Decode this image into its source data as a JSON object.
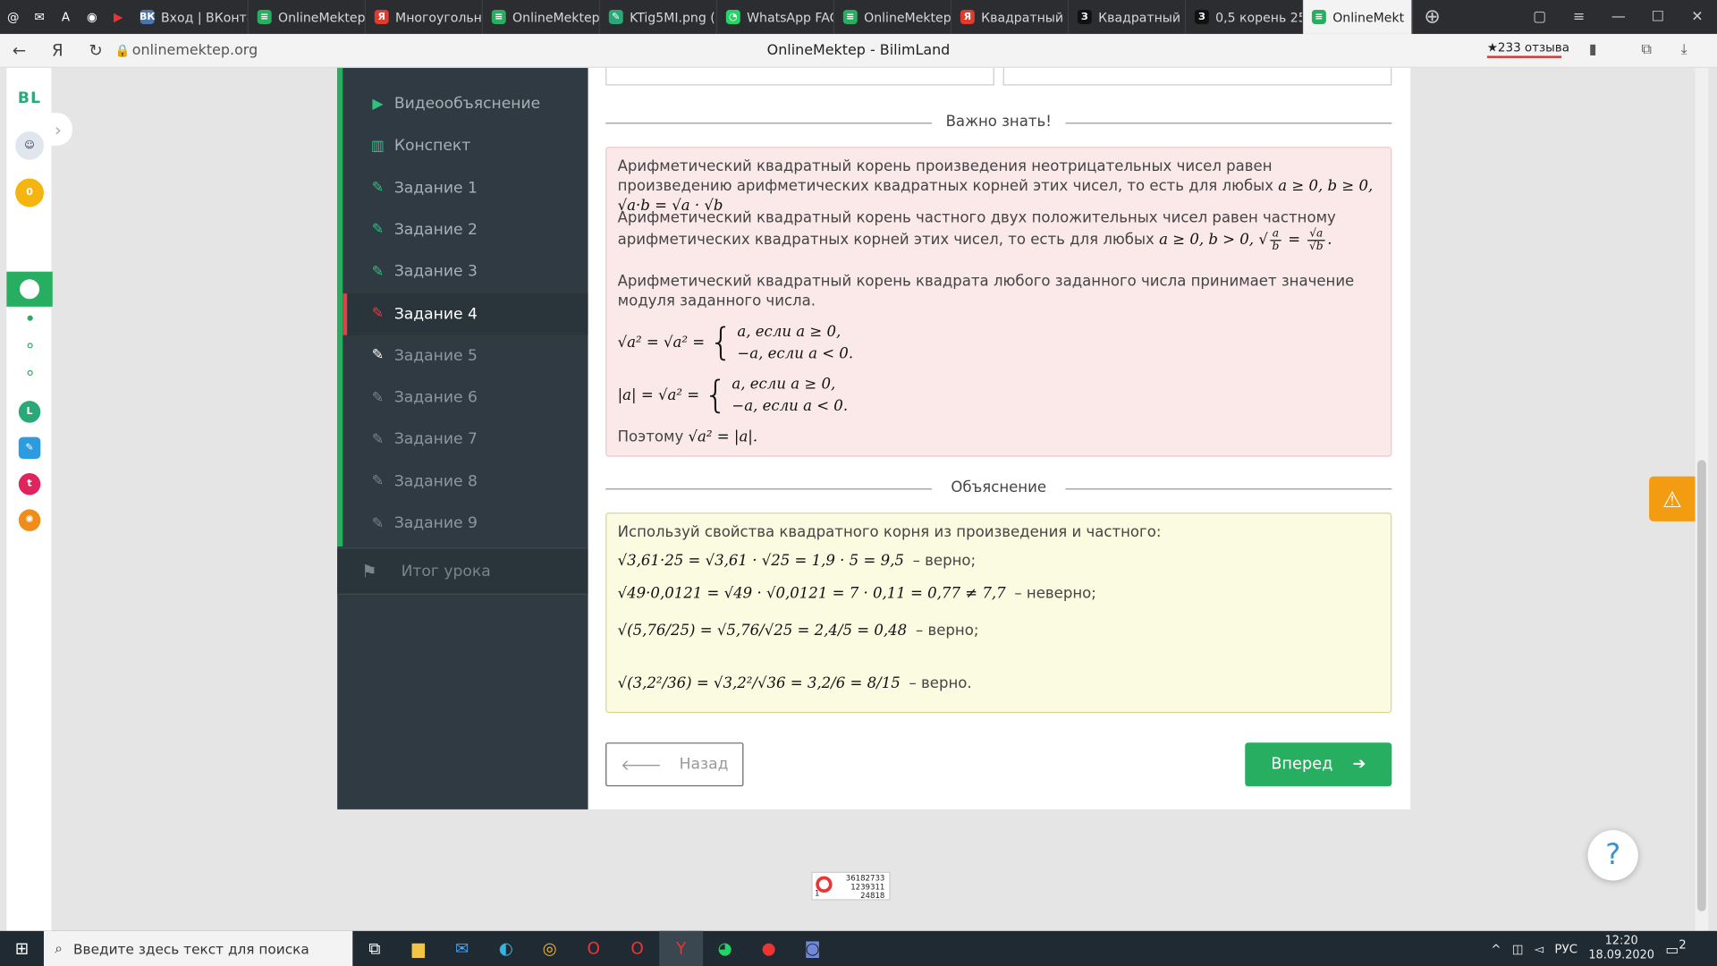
{
  "browser": {
    "tabs": [
      {
        "label": "Вход | ВКонта",
        "color": "#4a76a8",
        "glyph": "ВК"
      },
      {
        "label": "OnlineMektep",
        "color": "#27ae60",
        "glyph": "≡"
      },
      {
        "label": "Многоугольни",
        "color": "#e03b2c",
        "glyph": "Я"
      },
      {
        "label": "OnlineMektep",
        "color": "#27ae60",
        "glyph": "≡"
      },
      {
        "label": "KTig5MI.png (",
        "color": "#2aa878",
        "glyph": "✎"
      },
      {
        "label": "WhatsApp FAC",
        "color": "#25d366",
        "glyph": "◔"
      },
      {
        "label": "OnlineMektep",
        "color": "#27ae60",
        "glyph": "≡"
      },
      {
        "label": "Квадратный к",
        "color": "#e03b2c",
        "glyph": "Я"
      },
      {
        "label": "Квадратный к",
        "color": "#111111",
        "glyph": "З"
      },
      {
        "label": "0,5 корень 25(",
        "color": "#111111",
        "glyph": "З"
      }
    ],
    "active_tab": "OnlineMekt",
    "url": "onlinemektep.org",
    "page_title": "OnlineMektep - BilimLand",
    "reviews": "★233 отзыва"
  },
  "rail": {
    "logo": "BL",
    "coins": "0"
  },
  "sidebar": {
    "items": [
      {
        "label": "Видеообъяснение",
        "icon": "play-icon"
      },
      {
        "label": "Конспект",
        "icon": "book-icon"
      },
      {
        "label": "Задание 1",
        "icon": "edit-icon"
      },
      {
        "label": "Задание 2",
        "icon": "edit-icon"
      },
      {
        "label": "Задание 3",
        "icon": "edit-icon"
      },
      {
        "label": "Задание 4",
        "icon": "edit-icon"
      },
      {
        "label": "Задание 5",
        "icon": "edit-icon"
      },
      {
        "label": "Задание 6",
        "icon": "edit-icon"
      },
      {
        "label": "Задание 7",
        "icon": "edit-icon"
      },
      {
        "label": "Задание 8",
        "icon": "edit-icon"
      },
      {
        "label": "Задание 9",
        "icon": "edit-icon"
      }
    ],
    "finale": "Итог урока"
  },
  "important": {
    "heading": "Важно знать!",
    "p1": "Арифметический квадратный корень произведения неотрицательных чисел равен произведению арифметических квадратных корней этих чисел, то есть для любых",
    "p1_math": "a ≥ 0, b ≥ 0, √a·b = √a · √b",
    "p2": "Арифметический квадратный корень частного двух положительных чисел равен частному арифметических квадратных корней этих чисел, то есть для любых",
    "p2_math": "a ≥ 0, b > 0,",
    "p3": "Арифметический квадратный корень квадрата любого заданного числа принимает значение модуля заданного числа.",
    "case_pos": "a, если a ≥ 0,",
    "case_neg": "−a, если a < 0.",
    "conclusion": "Поэтому",
    "conclusion_math": "√a² = |a|."
  },
  "explanation": {
    "heading": "Объяснение",
    "intro": "Используй свойства квадратного корня из произведения и частного:",
    "lines": [
      {
        "math": "√3,61·25 = √3,61 · √25 = 1,9 · 5 = 9,5",
        "verdict": "– верно;"
      },
      {
        "math": "√49·0,0121 = √49 · √0,0121 = 7 · 0,11 = 0,77 ≠ 7,7",
        "verdict": "– неверно;"
      },
      {
        "math": "√(5,76/25) = √5,76/√25 = 2,4/5 = 0,48",
        "verdict": "– верно;"
      },
      {
        "math": "√(3,2²/36) = √3,2²/√36 = 3,2/6 = 8/15",
        "verdict": "– верно."
      }
    ]
  },
  "nav": {
    "back": "Назад",
    "next": "Вперед"
  },
  "counter": {
    "line1": "36182733",
    "line2": "1239311",
    "line3": "24818",
    "left": "1"
  },
  "taskbar": {
    "search_placeholder": "Введите здесь текст для поиска",
    "lang": "РУС",
    "time": "12:20",
    "date": "18.09.2020",
    "notif": "2"
  }
}
